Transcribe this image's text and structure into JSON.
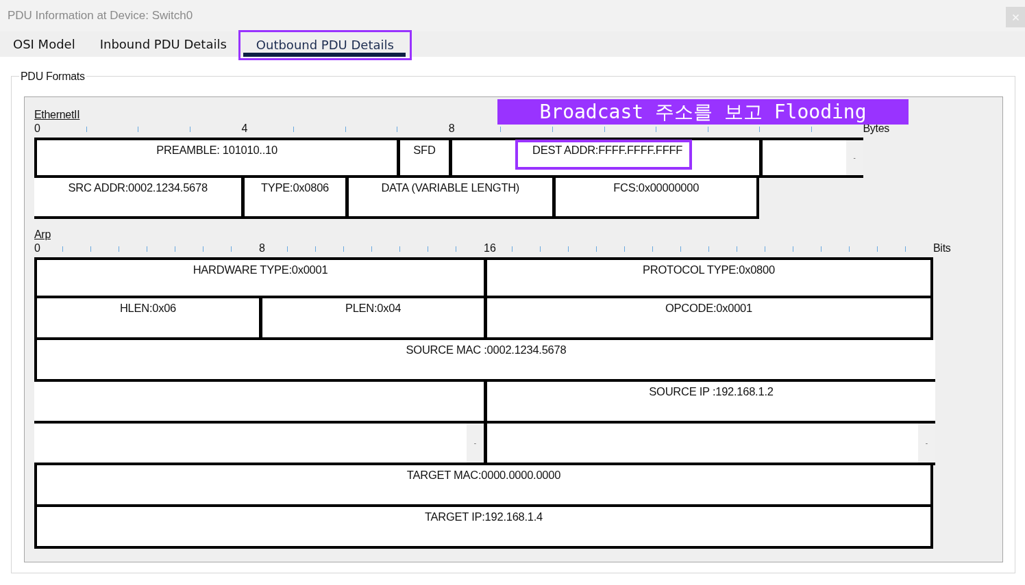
{
  "window": {
    "title": "PDU Information at Device: Switch0"
  },
  "tabs": [
    {
      "label": "OSI Model",
      "selected": false,
      "highlighted": false
    },
    {
      "label": "Inbound PDU Details",
      "selected": false,
      "highlighted": false
    },
    {
      "label": "Outbound PDU Details",
      "selected": true,
      "highlighted": true
    }
  ],
  "pdu_formats": {
    "title": "PDU Formats",
    "formats": [
      {
        "name": "EthernetII",
        "ruler": {
          "labels": [
            "0",
            "4",
            "8"
          ],
          "unit": "Bytes"
        },
        "lines": [
          {
            "fields": [
              {
                "kind": "field",
                "label": "PREAMBLE: 101010..10",
                "highlighted": false
              },
              {
                "kind": "field",
                "label": "SFD",
                "highlighted": false
              },
              {
                "kind": "field",
                "label": "DEST ADDR:FFFF.FFFF.FFFF",
                "highlighted": true
              },
              {
                "kind": "blank",
                "marker": "-",
                "highlighted": false
              }
            ]
          },
          {
            "fields": [
              {
                "kind": "field",
                "label": "SRC ADDR:0002.1234.5678",
                "highlighted": false
              },
              {
                "kind": "field",
                "label": "TYPE:0x0806",
                "highlighted": false
              },
              {
                "kind": "field",
                "label": "DATA (VARIABLE LENGTH)",
                "highlighted": false
              },
              {
                "kind": "field",
                "label": "FCS:0x00000000",
                "highlighted": false
              }
            ]
          }
        ]
      },
      {
        "name": "Arp",
        "ruler": {
          "labels": [
            "0",
            "8",
            "16"
          ],
          "unit": "Bits"
        },
        "lines": [
          {
            "fields": [
              {
                "kind": "field",
                "label": "HARDWARE TYPE:0x0001",
                "highlighted": false
              },
              {
                "kind": "field",
                "label": "PROTOCOL TYPE:0x0800",
                "highlighted": false
              }
            ]
          },
          {
            "fields": [
              {
                "kind": "field",
                "label": "HLEN:0x06",
                "highlighted": false
              },
              {
                "kind": "field",
                "label": "PLEN:0x04",
                "highlighted": false
              },
              {
                "kind": "field",
                "label": "OPCODE:0x0001",
                "highlighted": false
              }
            ]
          },
          {
            "fields": [
              {
                "kind": "field",
                "label": "SOURCE MAC :0002.1234.5678",
                "highlighted": false
              }
            ]
          },
          {
            "fields": [
              {
                "kind": "blank",
                "highlighted": false
              },
              {
                "kind": "field",
                "label": "SOURCE IP :192.168.1.2",
                "highlighted": false
              }
            ]
          },
          {
            "fields": [
              {
                "kind": "blank",
                "marker": "-",
                "highlighted": false
              },
              {
                "kind": "blank",
                "marker": "-",
                "highlighted": false
              }
            ]
          },
          {
            "fields": [
              {
                "kind": "field",
                "label": "TARGET MAC:0000.0000.0000",
                "highlighted": false
              }
            ]
          },
          {
            "fields": [
              {
                "kind": "field",
                "label": "TARGET IP:192.168.1.4",
                "highlighted": false
              }
            ]
          }
        ]
      }
    ]
  },
  "annotation": {
    "text": "Broadcast 주소를 보고 Flooding"
  }
}
